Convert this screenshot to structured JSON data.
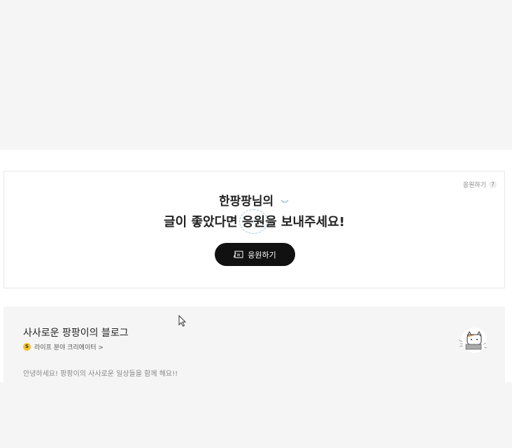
{
  "support": {
    "help_label": "응원하기",
    "help_icon": "?",
    "line1": "한팡팡님의",
    "line2_prefix": "글이 좋았다면 ",
    "line2_highlight": "응원",
    "line2_suffix": "을 보내주세요!",
    "button_label": "응원하기",
    "button_color": "#111111"
  },
  "blog": {
    "title": "사사로운 팡팡이의 블로그",
    "badge": "S",
    "creator_label": "라이프 분야 크리에이터 >",
    "description": "안녕하세요! 팡팡이의 사사로운 일상들을 함께 해요!!",
    "badge_color": "#f6c12a"
  },
  "icons": [
    "question-icon",
    "smile-icon",
    "coin-icon",
    "creator-badge-icon",
    "mascot-icon",
    "mouse-cursor-icon"
  ]
}
